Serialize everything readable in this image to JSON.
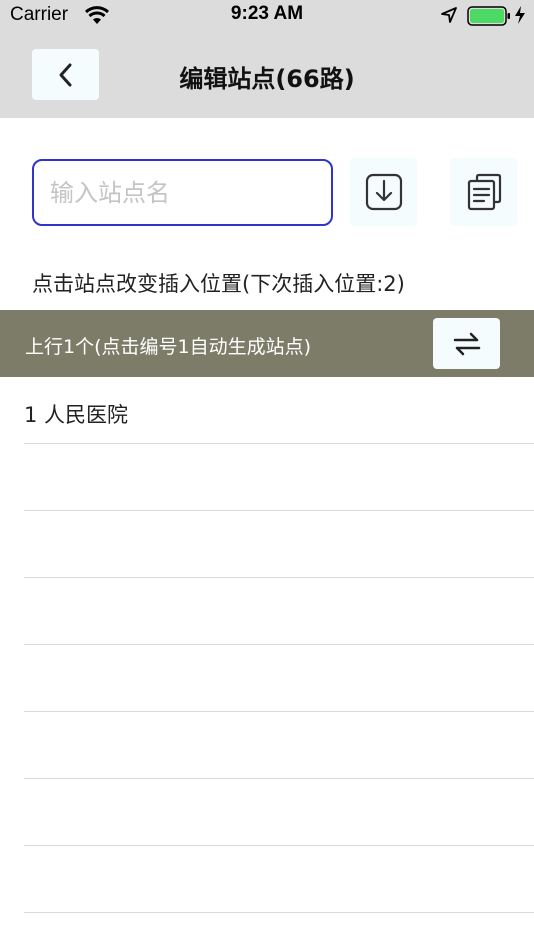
{
  "status_bar": {
    "carrier": "Carrier",
    "time": "9:23 AM",
    "battery_color": "#4cd964"
  },
  "nav": {
    "back_icon": "chevron-left-icon",
    "title": "编辑站点(66路)"
  },
  "search": {
    "placeholder": "输入站点名",
    "value": ""
  },
  "toolbar": {
    "import_icon": "download-icon",
    "copy_icon": "copy-icon"
  },
  "hint": "点击站点改变插入位置(下次插入位置:2)",
  "direction": {
    "label": "上行1个(点击编号1自动生成站点)",
    "swap_icon": "swap-arrows-icon",
    "bar_color": "#7c7c68"
  },
  "stations": [
    {
      "text": "1 人民医院"
    },
    {
      "text": ""
    },
    {
      "text": ""
    },
    {
      "text": ""
    },
    {
      "text": ""
    },
    {
      "text": ""
    },
    {
      "text": ""
    },
    {
      "text": ""
    }
  ]
}
